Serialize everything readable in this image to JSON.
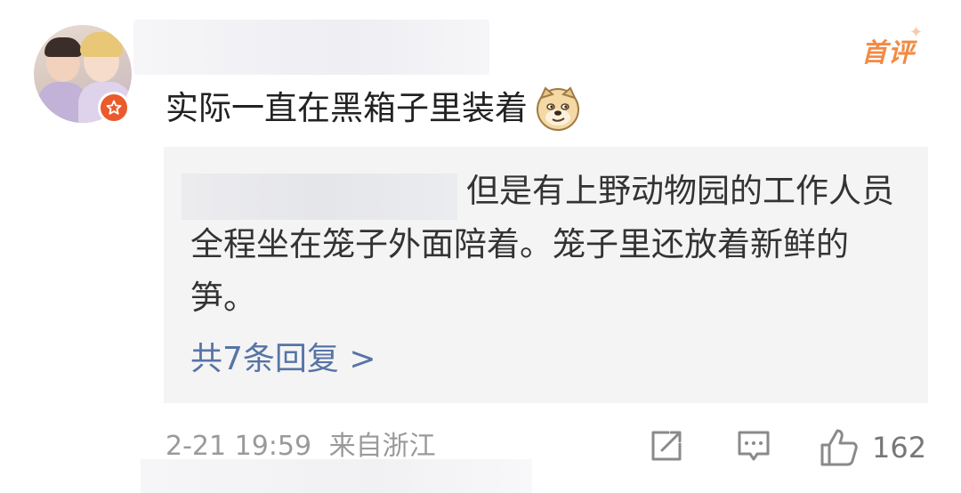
{
  "comment": {
    "text": "实际一直在黑箱子里装着",
    "emoji": "doge-emoji",
    "badge": "首评",
    "time": "2-21 19:59",
    "location": "来自浙江",
    "likes": "162"
  },
  "reply": {
    "text": "但是有上野动物园的工作人员全程坐在笼子外面陪着。笼子里还放着新鲜的笋。",
    "count_label": "共7条回复 >"
  },
  "colors": {
    "badge": "#f28a43",
    "link": "#5774a6",
    "verified": "#ea5a2b",
    "reply_bg": "#f4f4f4"
  },
  "icons": [
    "share-icon",
    "comment-icon",
    "like-icon",
    "verified-badge-icon"
  ]
}
